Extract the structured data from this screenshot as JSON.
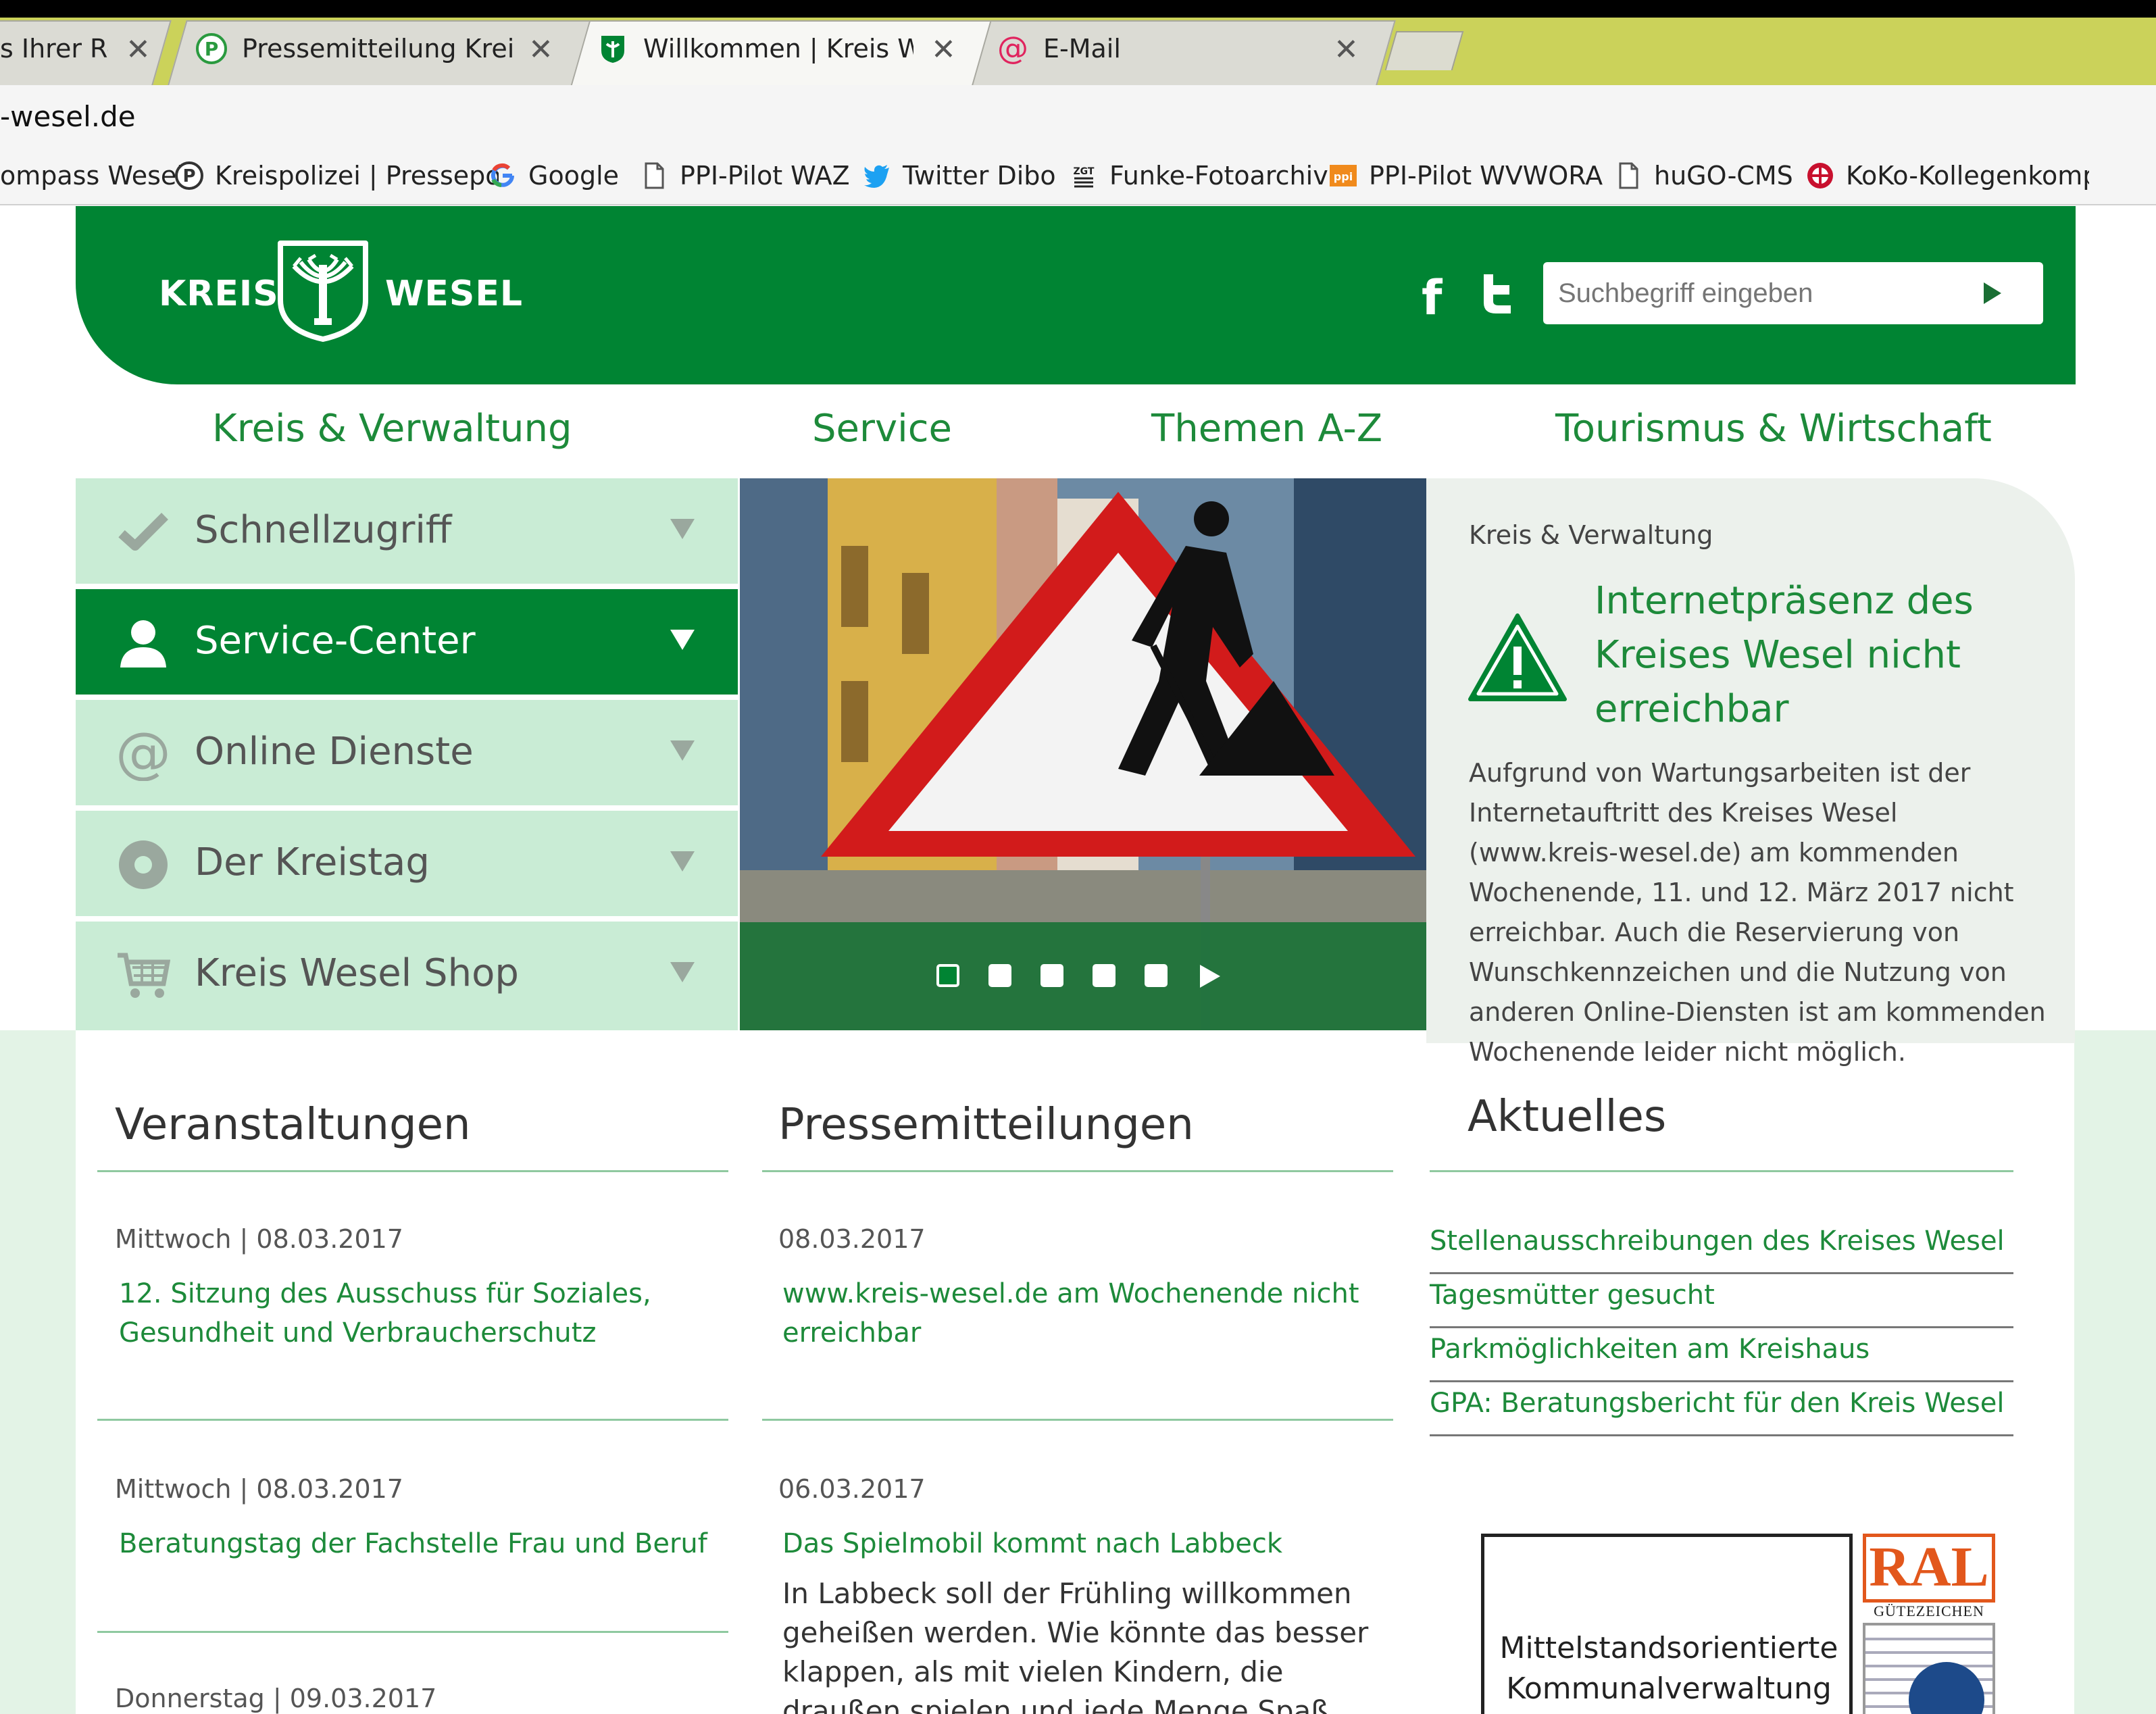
{
  "browser": {
    "tabs": [
      {
        "title": "s Ihrer Re",
        "favicon": "document-icon"
      },
      {
        "title": "Pressemitteilung Kreispo",
        "favicon": "p-circle-icon"
      },
      {
        "title": "Willkommen | Kreis Wese",
        "favicon": "kreis-wesel-shield-icon"
      },
      {
        "title": "E-Mail",
        "favicon": "at-sign-icon"
      }
    ],
    "close_glyph": "✕",
    "url": "-wesel.de",
    "bookmarks": [
      {
        "label": "ompass Wesel",
        "icon": "none"
      },
      {
        "label": "Kreispolizei | Pressepo",
        "icon": "p-circle-icon"
      },
      {
        "label": "Google",
        "icon": "google-g-icon"
      },
      {
        "label": "PPI-Pilot WAZ",
        "icon": "page-icon"
      },
      {
        "label": "Twitter Dibo",
        "icon": "twitter-bird-icon"
      },
      {
        "label": "Funke-Fotoarchiv",
        "icon": "funke-icon"
      },
      {
        "label": "PPI-Pilot WVWORA",
        "icon": "ppi-icon"
      },
      {
        "label": "huGO-CMS",
        "icon": "page-icon"
      },
      {
        "label": "KoKo-Kollegenkompa",
        "icon": "koko-icon"
      }
    ]
  },
  "header": {
    "logo_left": "KREIS",
    "logo_right": "WESEL",
    "facebook_glyph": "f",
    "search_placeholder": "Suchbegriff eingeben"
  },
  "mainnav": [
    "Kreis & Verwaltung",
    "Service",
    "Themen A-Z",
    "Tourismus & Wirtschaft"
  ],
  "sidebar": [
    {
      "label": "Schnellzugriff",
      "icon": "checkmark-icon",
      "active": false
    },
    {
      "label": "Service-Center",
      "icon": "person-icon",
      "active": true
    },
    {
      "label": "Online Dienste",
      "icon": "at-sign-icon",
      "active": false
    },
    {
      "label": "Der Kreistag",
      "icon": "circle-dot-icon",
      "active": false
    },
    {
      "label": "Kreis Wesel Shop",
      "icon": "shopping-cart-icon",
      "active": false
    }
  ],
  "slider": {
    "dots": 5,
    "active_dot": 1
  },
  "news": {
    "kicker": "Kreis & Verwaltung",
    "title": "Internetpräsenz des Kreises Wesel nicht erreichbar",
    "body": "Aufgrund von Wartungsarbeiten ist der Internetauftritt des Kreises Wesel (www.kreis-wesel.de) am kommenden Wochenende, 11. und 12. März 2017 nicht erreichbar. Auch die Reservierung von Wunschkennzeichen und die Nutzung von anderen Online-Diensten ist am kommenden Wochenende leider nicht möglich."
  },
  "veranstaltungen": {
    "heading": "Veranstaltungen",
    "items": [
      {
        "date": "Mittwoch | 08.03.2017",
        "title": "12. Sitzung des Ausschuss für Soziales, Gesundheit und Verbraucherschutz"
      },
      {
        "date": "Mittwoch | 08.03.2017",
        "title": "Beratungstag der Fachstelle Frau und Beruf"
      },
      {
        "date": "Donnerstag | 09.03.2017",
        "title": ""
      }
    ]
  },
  "pressemitteilungen": {
    "heading": "Pressemitteilungen",
    "items": [
      {
        "date": "08.03.2017",
        "title": "www.kreis-wesel.de am Wochenende nicht erreichbar",
        "teaser": ""
      },
      {
        "date": "06.03.2017",
        "title": "Das Spielmobil kommt nach Labbeck",
        "teaser": "In Labbeck soll der Frühling willkommen geheißen werden. Wie könnte das besser klappen, als mit vielen Kindern, die draußen spielen und jede Menge Spaß haben?"
      }
    ]
  },
  "aktuelles": {
    "heading": "Aktuelles",
    "links": [
      "Stellenausschreibungen des Kreises Wesel",
      "Tagesmütter gesucht",
      "Parkmöglichkeiten am Kreishaus",
      "GPA: Beratungsbericht für den Kreis Wesel"
    ]
  },
  "badge": {
    "text": "Mittelstandsorientierte Kommunalverwaltung",
    "ral": "RAL",
    "ral_sub": "GÜTEZEICHEN"
  },
  "colors": {
    "brand_green": "#008433",
    "link_green": "#1d8a3a",
    "light_green": "#c9ecd5",
    "tabstrip": "#cbd25a"
  }
}
